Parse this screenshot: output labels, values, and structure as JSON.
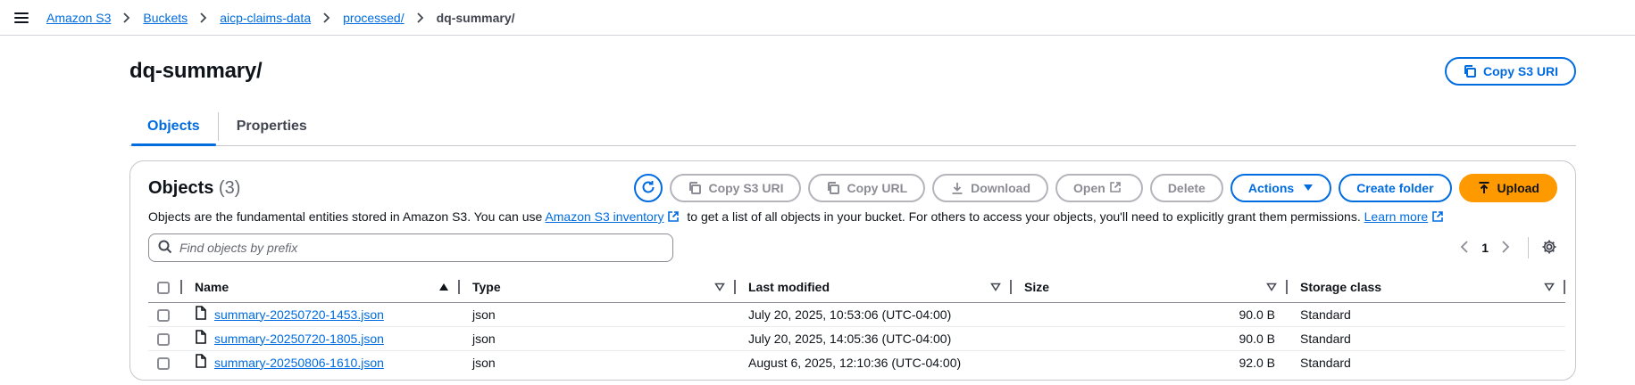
{
  "breadcrumbs": [
    {
      "label": "Amazon S3"
    },
    {
      "label": "Buckets"
    },
    {
      "label": "aicp-claims-data"
    },
    {
      "label": "processed/"
    }
  ],
  "breadcrumb_current": "dq-summary/",
  "page": {
    "title": "dq-summary/",
    "copy_uri_label": "Copy S3 URI"
  },
  "tabs": [
    {
      "label": "Objects",
      "active": true
    },
    {
      "label": "Properties",
      "active": false
    }
  ],
  "objects_panel": {
    "title": "Objects",
    "count": "(3)",
    "buttons": {
      "copy_s3_uri": "Copy S3 URI",
      "copy_url": "Copy URL",
      "download": "Download",
      "open": "Open",
      "delete": "Delete",
      "actions": "Actions",
      "create_folder": "Create folder",
      "upload": "Upload"
    },
    "description_before": "Objects are the fundamental entities stored in Amazon S3. You can use",
    "inventory_link": "Amazon S3 inventory",
    "description_middle": "to get a list of all objects in your bucket. For others to access your objects, you'll need to explicitly grant them permissions.",
    "learn_more": "Learn more",
    "search_placeholder": "Find objects by prefix",
    "page_number": "1"
  },
  "table": {
    "columns": {
      "name": "Name",
      "type": "Type",
      "last_modified": "Last modified",
      "size": "Size",
      "storage_class": "Storage class"
    },
    "rows": [
      {
        "name": "summary-20250720-1453.json",
        "type": "json",
        "last_modified": "July 20, 2025, 10:53:06 (UTC-04:00)",
        "size": "90.0 B",
        "storage_class": "Standard"
      },
      {
        "name": "summary-20250720-1805.json",
        "type": "json",
        "last_modified": "July 20, 2025, 14:05:36 (UTC-04:00)",
        "size": "90.0 B",
        "storage_class": "Standard"
      },
      {
        "name": "summary-20250806-1610.json",
        "type": "json",
        "last_modified": "August 6, 2025, 12:10:36 (UTC-04:00)",
        "size": "92.0 B",
        "storage_class": "Standard"
      }
    ]
  },
  "colors": {
    "link": "#006ce0",
    "primary": "#ff9900",
    "disabled": "#8c8c94"
  }
}
